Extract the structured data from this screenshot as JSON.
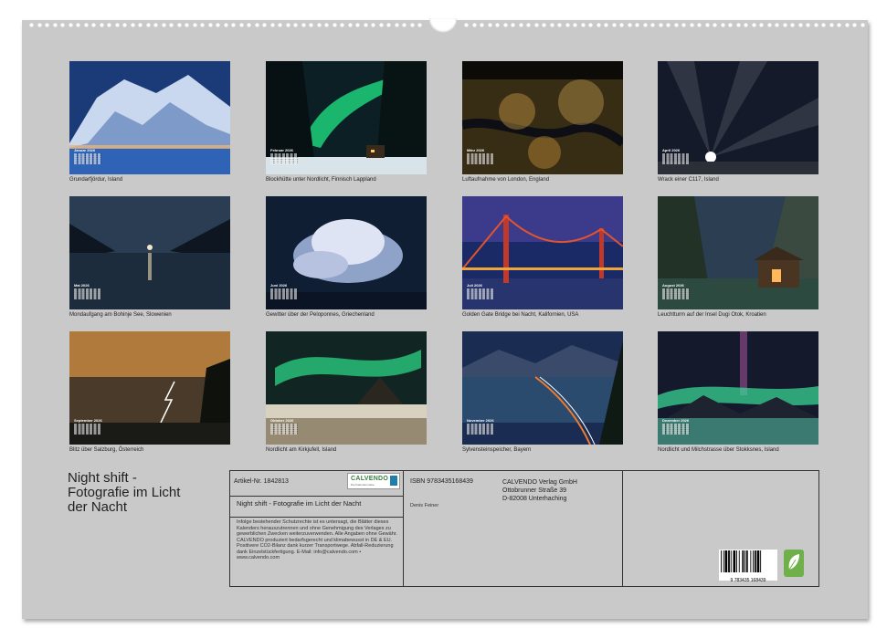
{
  "product_title": "Night shift - Fotografie im Licht der Nacht",
  "title_lines": [
    "Night shift -",
    "Fotografie im Licht",
    "der Nacht"
  ],
  "months": [
    {
      "month": "Januar 2026",
      "caption": "Grundarfjördur, Island"
    },
    {
      "month": "Februar 2026",
      "caption": "Blockhütte unter Nordlicht, Finnisch Lappland"
    },
    {
      "month": "März 2026",
      "caption": "Luftaufnahme von London, England"
    },
    {
      "month": "April 2026",
      "caption": "Wrack einer C117, Island"
    },
    {
      "month": "Mai 2026",
      "caption": "Mondaufgang am Bohinje See, Slowenien"
    },
    {
      "month": "Juni 2026",
      "caption": "Gewitter über der Peloponnes, Griechenland"
    },
    {
      "month": "Juli 2026",
      "caption": "Golden Gate Bridge bei Nacht, Kalifornien, USA"
    },
    {
      "month": "August 2026",
      "caption": "Leuchtturm auf der Insel Dugi Otok, Kroatien"
    },
    {
      "month": "September 2026",
      "caption": "Blitz über Salzburg, Österreich"
    },
    {
      "month": "Oktober 2026",
      "caption": "Nordlicht am Kirkjufell, Island"
    },
    {
      "month": "November 2026",
      "caption": "Sylvensteinspeicher, Bayern"
    },
    {
      "month": "Dezember 2026",
      "caption": "Nordlicht und Milchstrasse über Stokksnes, Island"
    }
  ],
  "info": {
    "article_label": "Artikel-Nr. 1842813",
    "calendar_title": "Night shift - Fotografie im Licht der Nacht",
    "legal_text": "Infolge bestehender Schutzrechte ist es untersagt, die Blätter dieses Kalenders herauszutrennen und ohne Genehmigung des Verlages zu gewerblichen Zwecken weiterzuverwenden. Alle Angaben ohne Gewähr. CALVENDO produziert bedarfsgerecht und klimabewusst in DE & EU. Positivere CO2-Bilanz dank kurzer Transportwege. Abfall-Reduzierung dank Einzelstückfertigung. E-Mail: info@calvendo.com • www.calvendo.com",
    "isbn": "ISBN 9783435168439",
    "author": "Denis Feiner",
    "publisher_lines": [
      "CALVENDO Verlag GmbH",
      "Ottobrunner Straße 39",
      "D-82008 Unterhaching"
    ],
    "logo_text": "CALVENDO",
    "logo_sub": "Die Kalendermarke",
    "barcode_digits": "9 783435 168439"
  }
}
